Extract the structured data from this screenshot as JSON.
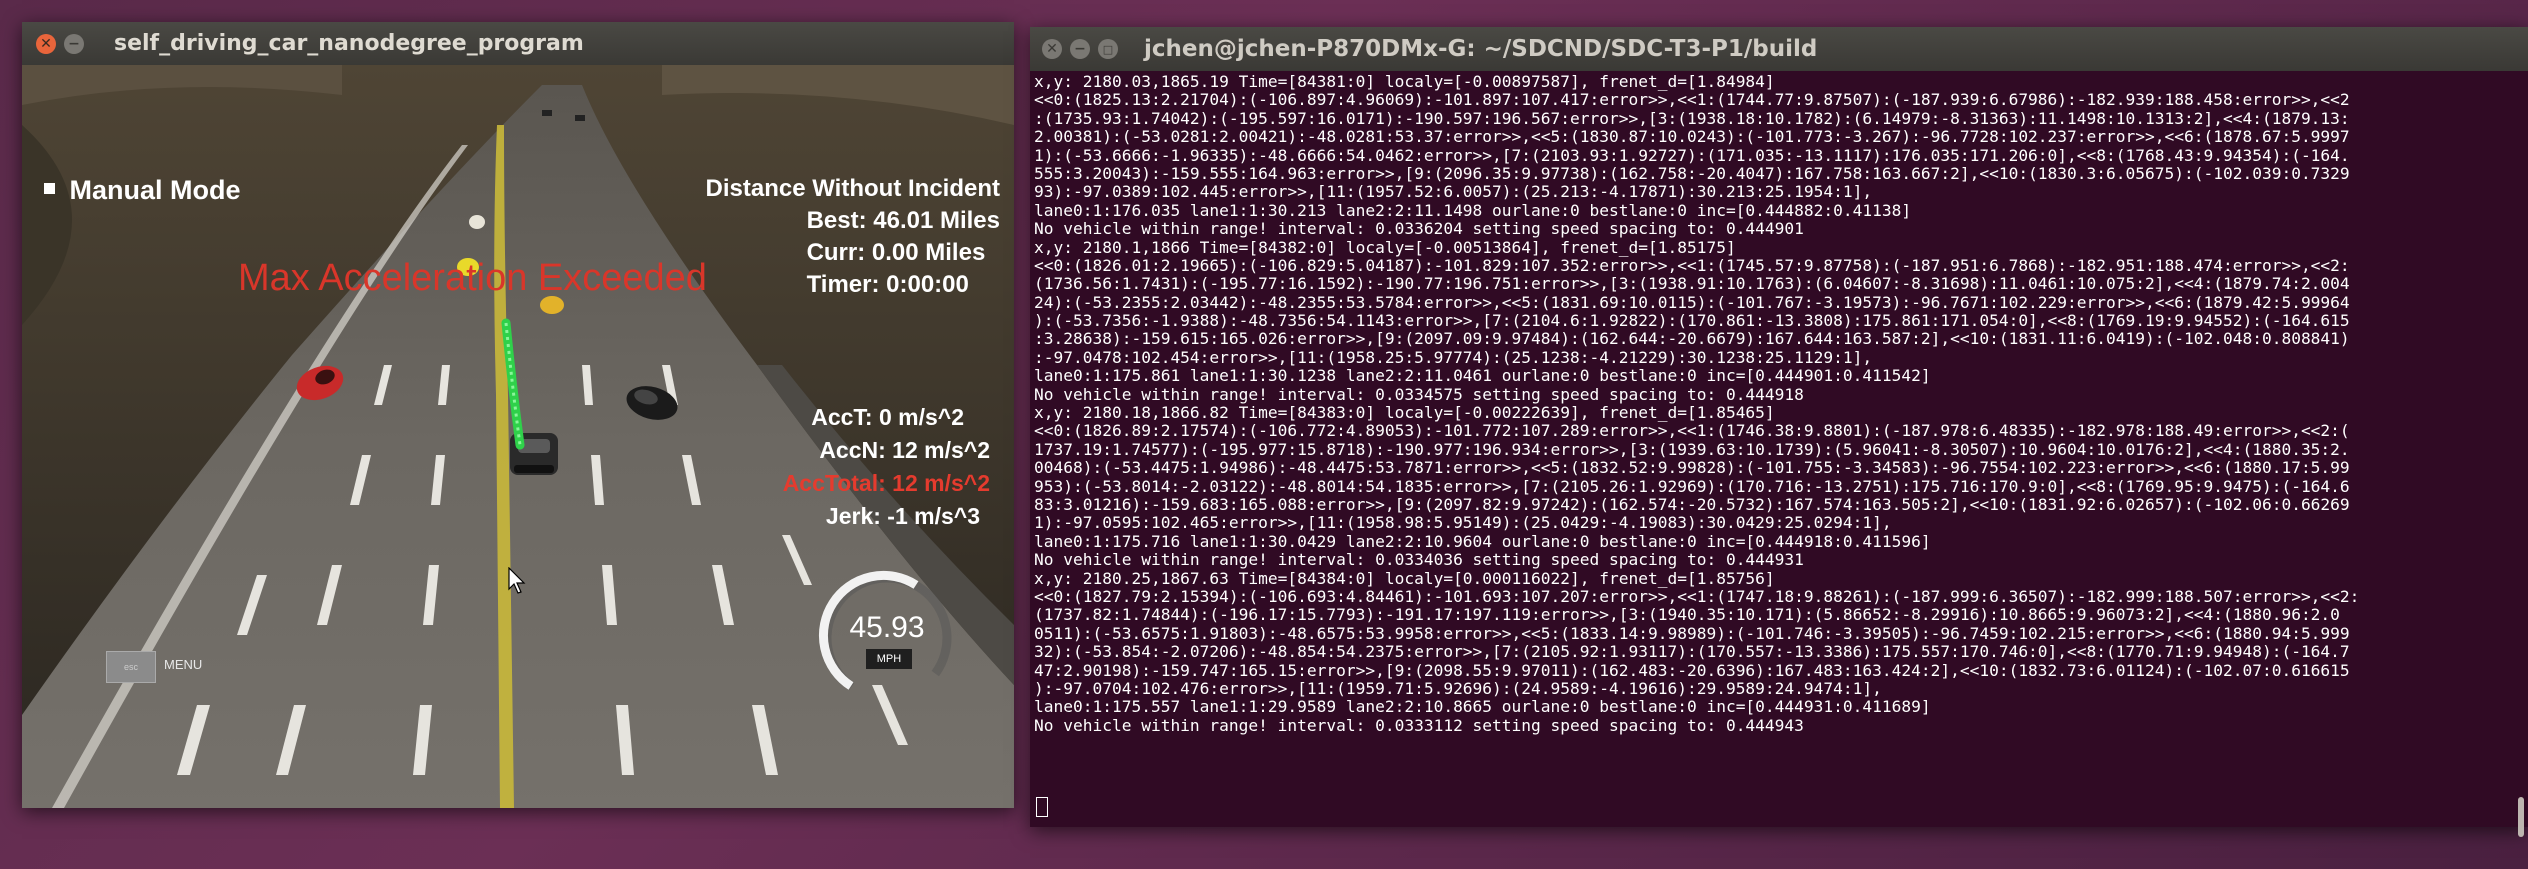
{
  "game": {
    "title": "self_driving_car_nanodegree_program",
    "manual_mode_label": "Manual Mode",
    "warning": "Max Acceleration Exceeded",
    "distance_heading": "Distance Without Incident",
    "best": "Best: 46.01 Miles",
    "curr": "Curr: 0.00 Miles",
    "timer": "Timer: 0:00:00",
    "acc_t": "AccT: 0 m/s^2",
    "acc_n": "AccN: 12 m/s^2",
    "acc_total": "AccTotal: 12 m/s^2",
    "jerk": "Jerk: -1 m/s^3",
    "speed_value": "45.93",
    "speed_unit": "MPH",
    "speed_fraction": 0.46,
    "esc_key": "esc",
    "menu_label": "MENU",
    "colors": {
      "warning": "#d9362a",
      "acc_total": "#e53b2e",
      "path": "#2fd14a"
    }
  },
  "terminal": {
    "title": "jchen@jchen-P870DMx-G: ~/SDCND/SDC-T3-P1/build",
    "lines": [
      "x,y: 2180.03,1865.19 Time=[84381:0] localy=[-0.00897587], frenet_d=[1.84984]",
      "<<0:(1825.13:2.21704):(-106.897:4.96069):-101.897:107.417:error>>,<<1:(1744.77:9.87507):(-187.939:6.67986):-182.939:188.458:error>>,<<2",
      ":(1735.93:1.74042):(-195.597:16.0171):-190.597:196.567:error>>,[3:(1938.18:10.1782):(6.14979:-8.31363):11.1498:10.1313:2],<<4:(1879.13:",
      "2.00381):(-53.0281:2.00421):-48.0281:53.37:error>>,<<5:(1830.87:10.0243):(-101.773:-3.267):-96.7728:102.237:error>>,<<6:(1878.67:5.9997",
      "1):(-53.6666:-1.96335):-48.6666:54.0462:error>>,[7:(2103.93:1.92727):(171.035:-13.1117):176.035:171.206:0],<<8:(1768.43:9.94354):(-164.",
      "555:3.20043):-159.555:164.963:error>>,[9:(2096.35:9.97738):(162.758:-20.4047):167.758:163.667:2],<<10:(1830.3:6.05675):(-102.039:0.7329",
      "93):-97.0389:102.445:error>>,[11:(1957.52:6.0057):(25.213:-4.17871):30.213:25.1954:1],",
      "lane0:1:176.035 lane1:1:30.213 lane2:2:11.1498 ourlane:0 bestlane:0 inc=[0.444882:0.41138]",
      "No vehicle within range! interval: 0.0336204 setting speed spacing to: 0.444901",
      "x,y: 2180.1,1866 Time=[84382:0] localy=[-0.00513864], frenet_d=[1.85175]",
      "<<0:(1826.01:2.19665):(-106.829:5.04187):-101.829:107.352:error>>,<<1:(1745.57:9.87758):(-187.951:6.7868):-182.951:188.474:error>>,<<2:",
      "(1736.56:1.7431):(-195.77:16.1592):-190.77:196.751:error>>,[3:(1938.91:10.1763):(6.04607:-8.31698):11.0461:10.075:2],<<4:(1879.74:2.004",
      "24):(-53.2355:2.03442):-48.2355:53.5784:error>>,<<5:(1831.69:10.0115):(-101.767:-3.19573):-96.7671:102.229:error>>,<<6:(1879.42:5.99964",
      "):(-53.7356:-1.9388):-48.7356:54.1143:error>>,[7:(2104.6:1.92822):(170.861:-13.3808):175.861:171.054:0],<<8:(1769.19:9.94552):(-164.615",
      ":3.28638):-159.615:165.026:error>>,[9:(2097.09:9.97484):(162.644:-20.6679):167.644:163.587:2],<<10:(1831.11:6.0419):(-102.048:0.808841)",
      ":-97.0478:102.454:error>>,[11:(1958.25:5.97774):(25.1238:-4.21229):30.1238:25.1129:1],",
      "lane0:1:175.861 lane1:1:30.1238 lane2:2:11.0461 ourlane:0 bestlane:0 inc=[0.444901:0.411542]",
      "No vehicle within range! interval: 0.0334575 setting speed spacing to: 0.444918",
      "x,y: 2180.18,1866.82 Time=[84383:0] localy=[-0.00222639], frenet_d=[1.85465]",
      "<<0:(1826.89:2.17574):(-106.772:4.89053):-101.772:107.289:error>>,<<1:(1746.38:9.8801):(-187.978:6.48335):-182.978:188.49:error>>,<<2:(",
      "1737.19:1.74577):(-195.977:15.8718):-190.977:196.934:error>>,[3:(1939.63:10.1739):(5.96041:-8.30507):10.9604:10.0176:2],<<4:(1880.35:2.",
      "00468):(-53.4475:1.94986):-48.4475:53.7871:error>>,<<5:(1832.52:9.99828):(-101.755:-3.34583):-96.7554:102.223:error>>,<<6:(1880.17:5.99",
      "953):(-53.8014:-2.03122):-48.8014:54.1835:error>>,[7:(2105.26:1.92969):(170.716:-13.2751):175.716:170.9:0],<<8:(1769.95:9.9475):(-164.6",
      "83:3.01216):-159.683:165.088:error>>,[9:(2097.82:9.97242):(162.574:-20.5732):167.574:163.505:2],<<10:(1831.92:6.02657):(-102.06:0.66269",
      "1):-97.0595:102.465:error>>,[11:(1958.98:5.95149):(25.0429:-4.19083):30.0429:25.0294:1],",
      "lane0:1:175.716 lane1:1:30.0429 lane2:2:10.9604 ourlane:0 bestlane:0 inc=[0.444918:0.411596]",
      "No vehicle within range! interval: 0.0334036 setting speed spacing to: 0.444931",
      "x,y: 2180.25,1867.63 Time=[84384:0] localy=[0.000116022], frenet_d=[1.85756]",
      "<<0:(1827.79:2.15394):(-106.693:4.84461):-101.693:107.207:error>>,<<1:(1747.18:9.88261):(-187.999:6.36507):-182.999:188.507:error>>,<<2:",
      "(1737.82:1.74844):(-196.17:15.7793):-191.17:197.119:error>>,[3:(1940.35:10.171):(5.86652:-8.29916):10.8665:9.96073:2],<<4:(1880.96:2.0",
      "0511):(-53.6575:1.91803):-48.6575:53.9958:error>>,<<5:(1833.14:9.98989):(-101.746:-3.39505):-96.7459:102.215:error>>,<<6:(1880.94:5.999",
      "32):(-53.854:-2.07206):-48.854:54.2375:error>>,[7:(2105.92:1.93117):(170.557:-13.3386):175.557:170.746:0],<<8:(1770.71:9.94948):(-164.7",
      "47:2.90198):-159.747:165.15:error>>,[9:(2098.55:9.97011):(162.483:-20.6396):167.483:163.424:2],<<10:(1832.73:6.01124):(-102.07:0.616615",
      "):-97.0704:102.476:error>>,[11:(1959.71:5.92696):(24.9589:-4.19616):29.9589:24.9474:1],",
      "lane0:1:175.557 lane1:1:29.9589 lane2:2:10.8665 ourlane:0 bestlane:0 inc=[0.444931:0.411689]",
      "No vehicle within range! interval: 0.0333112 setting speed spacing to: 0.444943"
    ]
  }
}
